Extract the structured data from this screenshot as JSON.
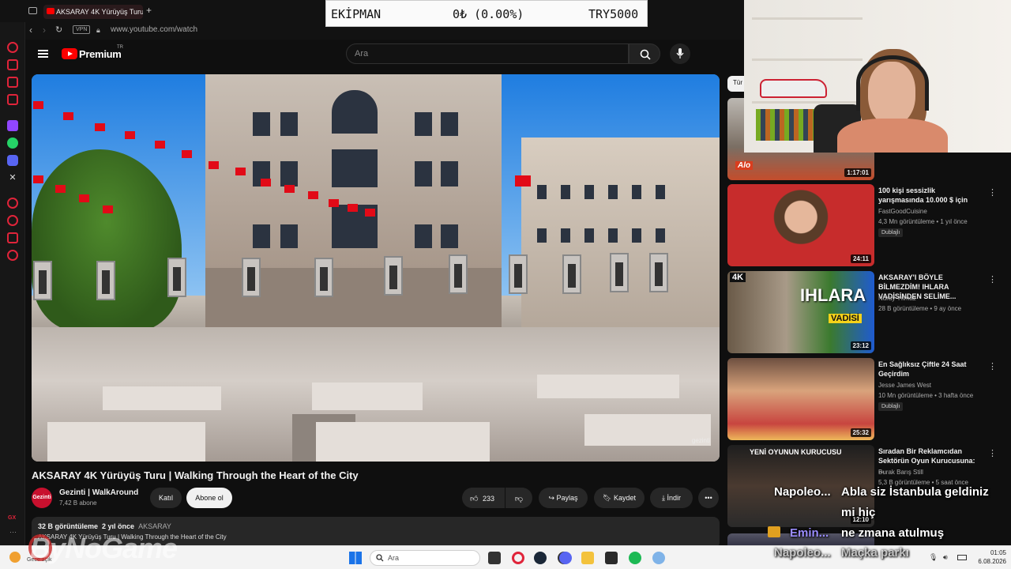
{
  "browser": {
    "tab_title": "AKSARAY 4K Yürüyüş Turu",
    "new_tab": "+",
    "url": "www.youtube.com/watch",
    "vpn_label": "VPN",
    "back_icon": "chevron-left-icon",
    "forward_icon": "chevron-right-icon",
    "reload_icon": "reload-icon"
  },
  "overlay": {
    "label": "EKİPMAN",
    "change": "0₺ (0.00%)",
    "value": "TRY5000"
  },
  "youtube": {
    "logo_text": "Premium",
    "logo_sup": "TR",
    "search_placeholder": "Ara"
  },
  "video": {
    "watermark": "gezinti",
    "title": "AKSARAY 4K Yürüyüş Turu | Walking Through the Heart of the City",
    "channel_avatar_text": "Gezinti",
    "channel_name": "Gezinti | WalkAround",
    "subscribers": "7,42 B abone",
    "join_label": "Katıl",
    "subscribe_label": "Abone ol",
    "likes": "233",
    "share_label": "Paylaş",
    "save_label": "Kaydet",
    "download_label": "İndir",
    "more_label": "•••",
    "views": "32 B görüntüleme",
    "age": "2 yıl önce",
    "tag": "AKSARAY",
    "description_line": "AKSARAY 4K Yürüyüş Turu | Walking Through the Heart of the City"
  },
  "recommendations": {
    "chip_partial": "Tür",
    "items": [
      {
        "duration": "1:17:01",
        "title": "",
        "channel": "",
        "meta": "",
        "badge": ""
      },
      {
        "duration": "24:11",
        "title": "100 kişi sessizlik yarışmasında 10.000 $ için",
        "channel": "FastGoodCuisine",
        "meta": "4,3 Mn görüntüleme • 1 yıl önce",
        "badge": "Dublajlı"
      },
      {
        "duration": "23:12",
        "title": "AKSARAY'I BÖYLE BİLMEZDİM! IHLARA VADİSİNDEN SELİME...",
        "channel": "Nuray Yılmaz",
        "meta": "28 B görüntüleme • 9 ay önce",
        "badge": ""
      },
      {
        "duration": "25:32",
        "title": "En Sağlıksız Çiftle 24 Saat Geçirdim",
        "channel": "Jesse James West",
        "meta": "10 Mn görüntüleme • 3 hafta önce",
        "badge": "Dublajlı"
      },
      {
        "duration": "12:10",
        "title": "Sıradan Bir Reklamcıdan Sektörün Oyun Kurucusuna: ...",
        "channel": "Burak Barış Still",
        "meta": "5,3 B görüntüleme • 5 saat önce",
        "badge": ""
      }
    ],
    "thumb_texts": {
      "aksaray_4k": "4K",
      "ihlara": "IHLARA",
      "vadisi": "VADİSİ",
      "oyun": "YENİ OYUNUN KURUCUSU",
      "alo": "Alo"
    }
  },
  "subtitles": {
    "left1": "Napoleo...",
    "right1": "Abla siz İstanbula geldiniz",
    "right2": "mi hiç",
    "right3": "ne zmana atulmuş",
    "left2": "Emin...",
    "left3": "Napoleo...",
    "right4": "Maçka parkı"
  },
  "taskbar": {
    "search_placeholder": "Ara",
    "time": "01:05",
    "date": "6.08.2026",
    "weather": "Gece açık"
  },
  "stream_logo": "ByNoGame",
  "sidebar_label": "GX",
  "colors": {
    "yt_red": "#ff0000",
    "bg": "#0f0f0f",
    "opera_red": "#e0243a"
  }
}
